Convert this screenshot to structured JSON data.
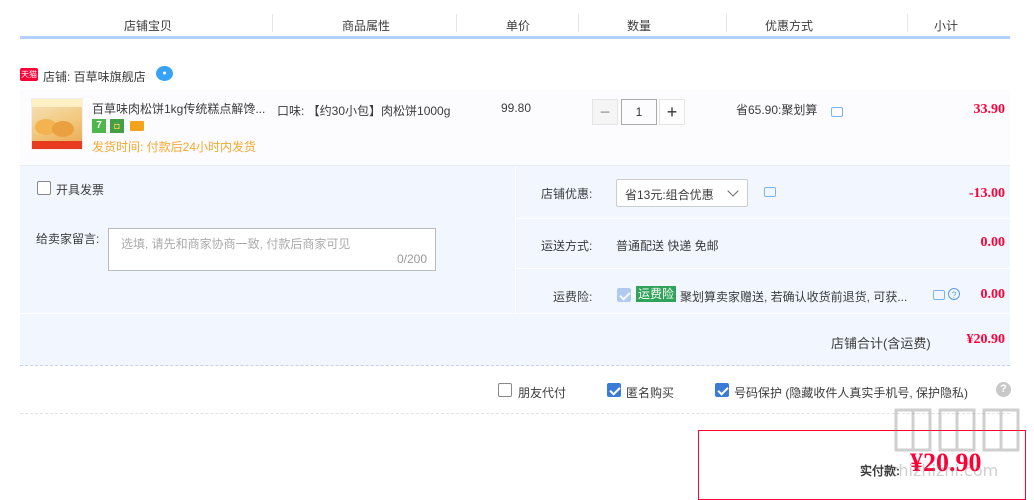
{
  "header": {
    "columns": [
      "店铺宝贝",
      "商品属性",
      "单价",
      "数量",
      "优惠方式",
      "小计"
    ]
  },
  "shop": {
    "badge": "天猫",
    "name": "店铺: 百草味旗舰店"
  },
  "item": {
    "title": "百草味肉松饼1kg传统糕点解馋...",
    "ship_time": "发货时间: 付款后24小时内发货",
    "attr": "口味: 【约30小包】肉松饼1000g",
    "unit_price": "99.80",
    "quantity": "1",
    "minus": "−",
    "plus": "+",
    "promo": "省65.90:聚划算",
    "subtotal": "33.90"
  },
  "invoice": {
    "label": "开具发票",
    "checked": false
  },
  "memo": {
    "label": "给卖家留言:",
    "placeholder": "选填, 请先和商家协商一致, 付款后商家可见",
    "counter": "0/200"
  },
  "shop_discount": {
    "label": "店铺优惠:",
    "selected": "省13元:组合优惠",
    "amount": "-13.00"
  },
  "shipping": {
    "label": "运送方式:",
    "value": "普通配送 快递 免邮",
    "amount": "0.00"
  },
  "insurance": {
    "label": "运费险:",
    "badge": "运费险",
    "text": "聚划算卖家赠送, 若确认收货前退货, 可获...",
    "amount": "0.00"
  },
  "shop_total": {
    "label": "店铺合计(含运费)",
    "amount": "¥20.90"
  },
  "options": {
    "friend_pay": {
      "label": "朋友代付",
      "checked": false
    },
    "anonymous": {
      "label": "匿名购买",
      "checked": true
    },
    "privacy": {
      "label": "号码保护 (隐藏收件人真实手机号, 保护隐私)",
      "checked": true
    },
    "help": "?"
  },
  "payment": {
    "label": "实付款:",
    "amount": "¥20.90"
  },
  "watermark": "值 值 值 zhizhizhi.com",
  "colors": {
    "accent": "#ff0036",
    "header_border": "#b2d1ff",
    "panel": "#f2f7ff",
    "ship_time": "#f4a82c"
  }
}
